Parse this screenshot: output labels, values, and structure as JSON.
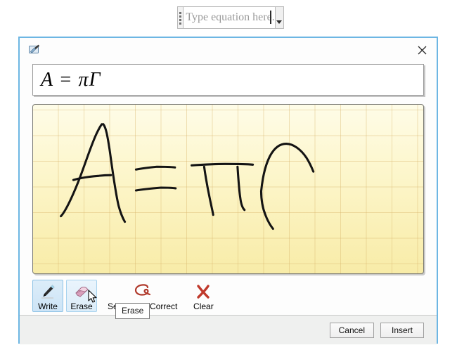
{
  "equation_control": {
    "placeholder": "Type equation here.",
    "grip_icon": "drag-grip-icon",
    "dropdown_icon": "chevron-down-icon"
  },
  "dialog": {
    "icon": "ink-equation-icon",
    "close_icon": "close-icon",
    "preview": {
      "equation": "A = πΓ",
      "label": "equation-preview"
    },
    "canvas": {
      "label": "ink-writing-canvas",
      "background_color": "#faf0ba",
      "grid_color": "#d6b268",
      "ink_color": "#141414",
      "strokes": [
        "A",
        "=",
        "π",
        "Γ"
      ]
    },
    "toolbar": {
      "items": [
        {
          "label": "Write",
          "icon": "pen-icon",
          "state": "selected"
        },
        {
          "label": "Erase",
          "icon": "eraser-icon",
          "state": "hovered"
        },
        {
          "label": "Select and Correct",
          "icon": "lasso-icon",
          "state": "normal"
        },
        {
          "label": "Clear",
          "icon": "red-x-icon",
          "state": "normal"
        }
      ]
    },
    "tooltip": {
      "text": "Erase",
      "cursor_icon": "mouse-pointer-icon"
    },
    "footer": {
      "cancel_label": "Cancel",
      "insert_label": "Insert"
    }
  },
  "colors": {
    "dialog_border": "#6db6e3",
    "accent_selected": "#8fc3e6",
    "footer_background": "#eff0ef"
  }
}
